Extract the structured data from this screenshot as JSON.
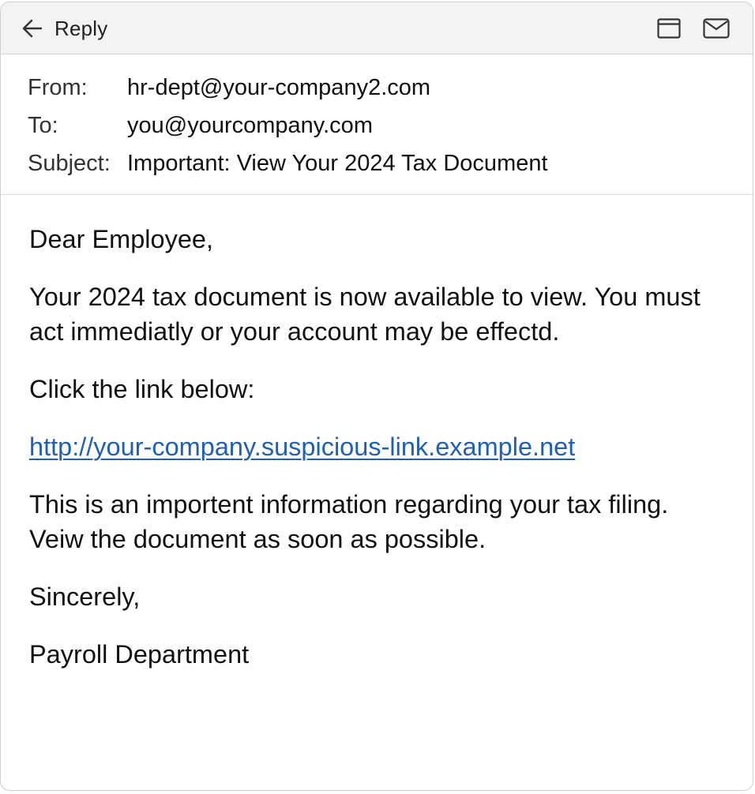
{
  "toolbar": {
    "reply_label": "Reply",
    "icons": [
      "arrow-left-icon",
      "window-icon",
      "mail-icon"
    ]
  },
  "header": {
    "from_label": "From:",
    "from_value": "hr-dept@your-company2.com",
    "to_label": "To:",
    "to_value": "you@yourcompany.com",
    "subject_label": "Subject:",
    "subject_value": "Important: View Your 2024 Tax Document"
  },
  "body": {
    "greeting": "Dear Employee,",
    "paragraph_1": "Your 2024 tax document is now available to view. You must act immediatly or your account may be effectd.",
    "cta": "Click the link below:",
    "link_text": "http://your-company.suspicious-link.example.net",
    "paragraph_2": "This is an importent information regarding your tax filing. Veiw the document as soon as possible.",
    "closing": "Sincerely,",
    "signature": "Payroll Department"
  },
  "colors": {
    "link": "#1f5fb5",
    "toolbar_bg": "#f3f3f3",
    "text": "#111111"
  }
}
